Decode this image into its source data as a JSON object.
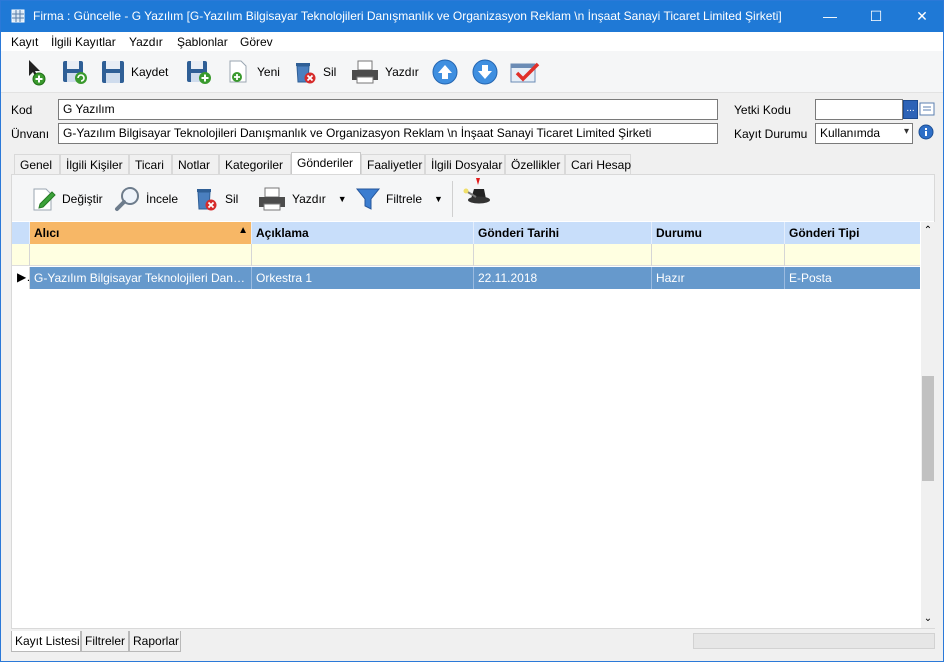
{
  "window": {
    "title": "Firma : Güncelle - G Yazılım [G-Yazılım Bilgisayar Teknolojileri Danışmanlık ve Organizasyon Reklam  \\n İnşaat Sanayi Ticaret Limited Şirketi]",
    "minimize": "—",
    "maximize": "☐",
    "close": "✕"
  },
  "menu": [
    "Kayıt",
    "İlgili Kayıtlar",
    "Yazdır",
    "Şablonlar",
    "Görev"
  ],
  "toolbar": {
    "save_label": "Kaydet",
    "new_label": "Yeni",
    "delete_label": "Sil",
    "print_label": "Yazdır"
  },
  "form": {
    "kod_label": "Kod",
    "kod_value": "G Yazılım",
    "unvan_label": "Ünvanı",
    "unvan_value": "G-Yazılım Bilgisayar Teknolojileri Danışmanlık ve Organizasyon Reklam  \\n İnşaat Sanayi Ticaret Limited Şirketi",
    "yetki_label": "Yetki Kodu",
    "yetki_value": "",
    "yetki_button": "...",
    "durum_label": "Kayıt Durumu",
    "durum_value": "Kullanımda"
  },
  "tabs": [
    "Genel",
    "İlgili Kişiler",
    "Ticari",
    "Notlar",
    "Kategoriler",
    "Gönderiler",
    "Faaliyetler",
    "İlgili Dosyalar",
    "Özellikler",
    "Cari Hesap"
  ],
  "active_tab": "Gönderiler",
  "subtoolbar": {
    "edit_label": "Değiştir",
    "view_label": "İncele",
    "delete_label": "Sil",
    "print_label": "Yazdır",
    "filter_label": "Filtrele"
  },
  "grid": {
    "columns": [
      "Alıcı",
      "Açıklama",
      "Gönderi Tarihi",
      "Durumu",
      "Gönderi Tipi"
    ],
    "rows": [
      [
        "G-Yazılım Bilgisayar Teknolojileri Danış..",
        "Orkestra 1",
        "22.11.2018",
        "Hazır",
        "E-Posta"
      ]
    ]
  },
  "bottom_tabs": [
    "Kayıt Listesi",
    "Filtreler",
    "Raporlar"
  ],
  "colors": {
    "titlebar": "#1f79d6",
    "grid_header": "#c8defa",
    "sorted_header": "#f7b766",
    "selected_row": "#6699cc",
    "filter_row": "#ffffe1"
  }
}
